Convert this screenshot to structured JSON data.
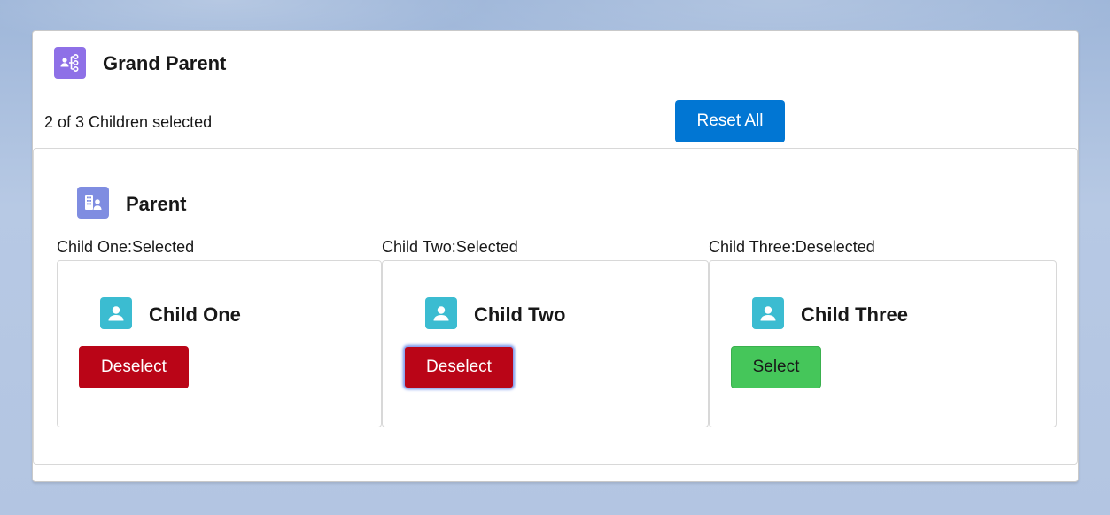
{
  "grand_parent": {
    "title": "Grand Parent",
    "icon": "hierarchy-icon",
    "summary": "2 of 3 Children selected",
    "reset_label": "Reset All"
  },
  "parent": {
    "title": "Parent",
    "icon": "building-person-icon"
  },
  "children": [
    {
      "status": "Child One:Selected",
      "title": "Child One",
      "button_label": "Deselect",
      "selected": true
    },
    {
      "status": "Child Two:Selected",
      "title": "Child Two",
      "button_label": "Deselect",
      "selected": true
    },
    {
      "status": "Child Three:Deselected",
      "title": "Child Three",
      "button_label": "Select",
      "selected": false
    }
  ],
  "colors": {
    "grand_parent_icon": "#8e70e7",
    "parent_icon": "#7f8de1",
    "child_icon": "#3bbcd1",
    "brand": "#0176d3",
    "deselect": "#ba0517",
    "select": "#45c65a"
  }
}
